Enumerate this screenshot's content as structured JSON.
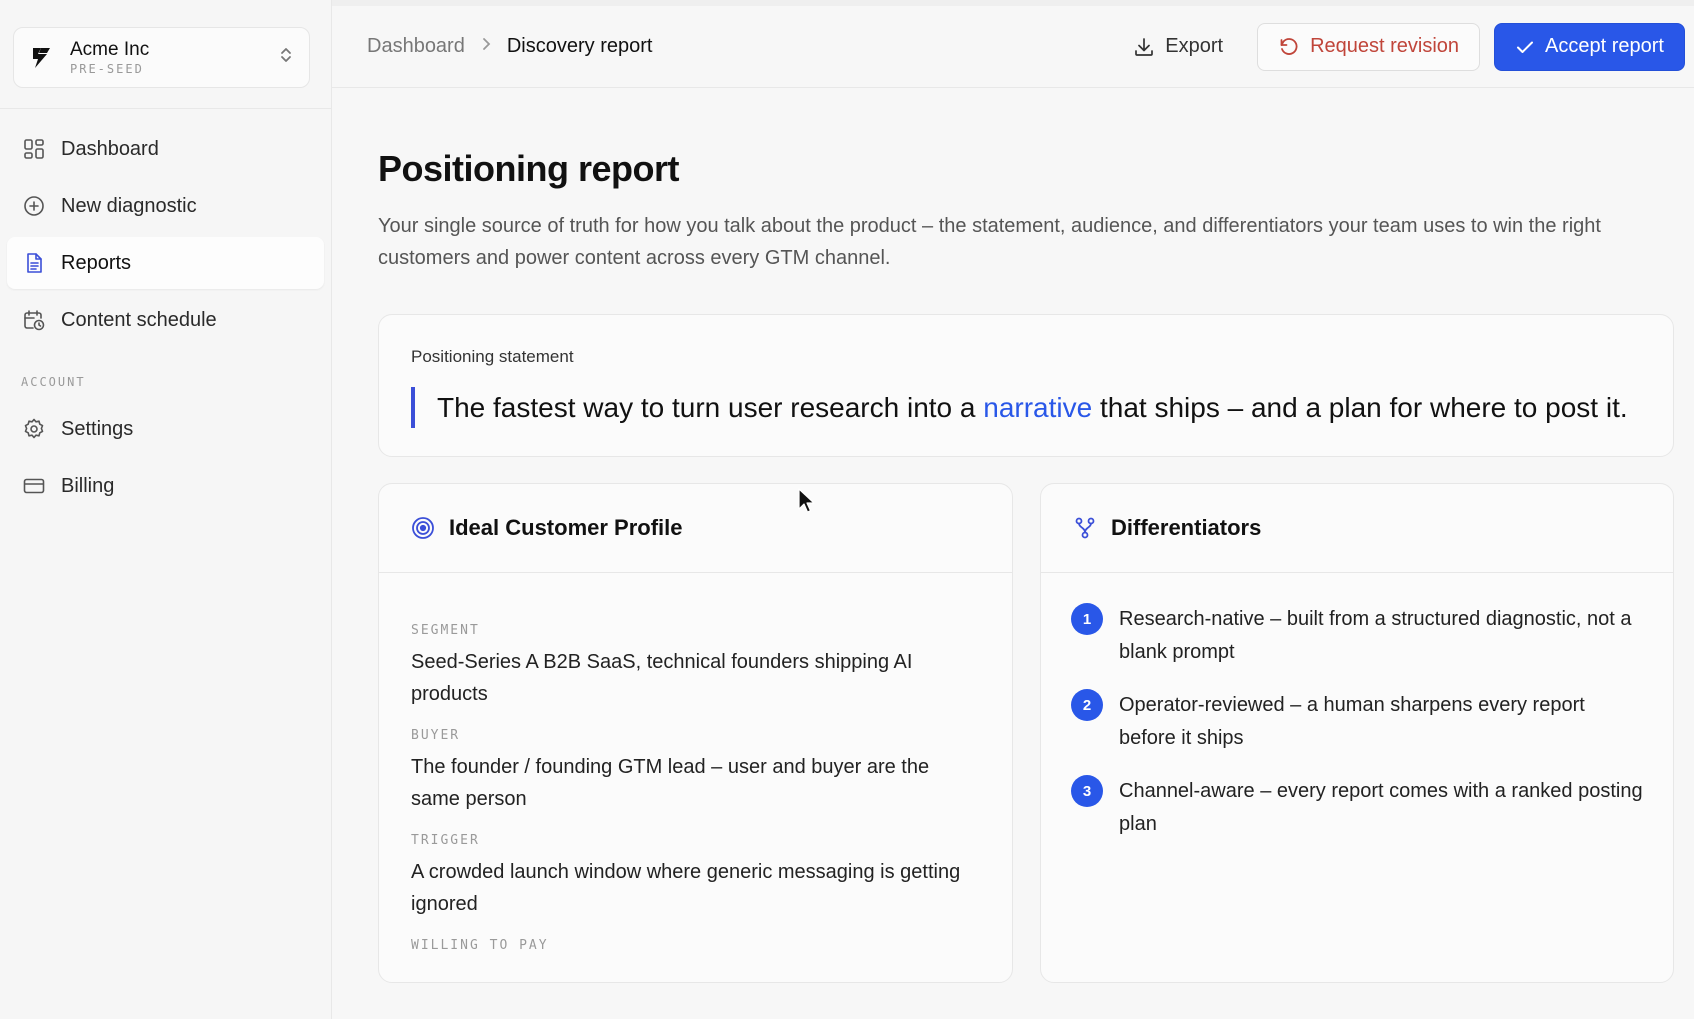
{
  "workspace": {
    "name": "Acme Inc",
    "plan": "PRE-SEED"
  },
  "sidebar": {
    "items": [
      {
        "label": "Dashboard",
        "icon": "dashboard-icon"
      },
      {
        "label": "New diagnostic",
        "icon": "plus-circle-icon"
      },
      {
        "label": "Reports",
        "icon": "document-icon",
        "active": true
      },
      {
        "label": "Content schedule",
        "icon": "calendar-clock-icon"
      }
    ],
    "account_section": "ACCOUNT",
    "account_items": [
      {
        "label": "Settings",
        "icon": "gear-icon"
      },
      {
        "label": "Billing",
        "icon": "credit-card-icon"
      }
    ]
  },
  "header": {
    "breadcrumb_parent": "Dashboard",
    "breadcrumb_current": "Discovery report",
    "export_label": "Export",
    "revision_label": "Request revision",
    "accept_label": "Accept report"
  },
  "page": {
    "title": "Positioning report",
    "description": "Your single source of truth for how you talk about the product – the statement, audience, and differentiators your team uses to win the right customers and power content across every GTM channel."
  },
  "statement": {
    "label": "Positioning statement",
    "text_before": "The fastest way to turn user research into a ",
    "highlight": "narrative",
    "text_after": " that ships – and a plan for where to post it."
  },
  "icp": {
    "title": "Ideal Customer Profile",
    "fields": [
      {
        "label": "SEGMENT",
        "value": "Seed-Series A B2B SaaS, technical founders shipping AI products"
      },
      {
        "label": "BUYER",
        "value": "The founder / founding GTM lead – user and buyer are the same person"
      },
      {
        "label": "TRIGGER",
        "value": "A crowded launch window where generic messaging is getting ignored"
      },
      {
        "label": "WILLING TO PAY",
        "value": ""
      }
    ]
  },
  "differentiators": {
    "title": "Differentiators",
    "items": [
      {
        "num": "1",
        "text": "Research-native – built from a structured diagnostic, not a blank prompt"
      },
      {
        "num": "2",
        "text": "Operator-reviewed – a human sharpens every report before it ships"
      },
      {
        "num": "3",
        "text": "Channel-aware – every report comes with a ranked posting plan"
      }
    ]
  },
  "colors": {
    "accent": "#2957e8",
    "danger": "#c0453a",
    "quote_bar": "#3b4fd8"
  }
}
